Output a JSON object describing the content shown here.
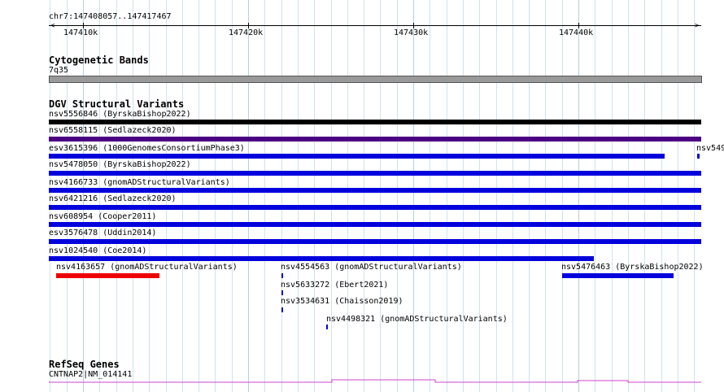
{
  "ruler": {
    "location": "chr7:147408057..147417467",
    "ticks": [
      "147410k",
      "147420k",
      "147430k",
      "147440k"
    ]
  },
  "tracks": {
    "cytoband": {
      "title": "Cytogenetic Bands",
      "band": "7q35",
      "color": "#999999"
    },
    "dgv": {
      "title": "DGV Structural Variants",
      "features": [
        {
          "label": "nsv5556846 (ByrskaBishop2022)",
          "color": "#000000"
        },
        {
          "label": "nsv6558115 (Sedlazeck2020)",
          "color": "#4b0082"
        },
        {
          "label": "esv3615396 (1000GenomesConsortiumPhase3)",
          "color": "#0000dd"
        },
        {
          "label": "nsv549",
          "color": "#0000dd"
        },
        {
          "label": "nsv5478050 (ByrskaBishop2022)",
          "color": "#0000dd"
        },
        {
          "label": "nsv4166733 (gnomADStructuralVariants)",
          "color": "#0000dd"
        },
        {
          "label": "nsv6421216 (Sedlazeck2020)",
          "color": "#0000dd"
        },
        {
          "label": "nsv608954 (Cooper2011)",
          "color": "#0000dd"
        },
        {
          "label": "esv3576478 (Uddin2014)",
          "color": "#0000dd"
        },
        {
          "label": "nsv1024540 (Coe2014)",
          "color": "#0000dd"
        },
        {
          "label": "nsv4163657 (gnomADStructuralVariants)",
          "color": "#ee0000"
        },
        {
          "label": "nsv4554563 (gnomADStructuralVariants)",
          "color": "#0000dd"
        },
        {
          "label": "nsv5476463 (ByrskaBishop2022)",
          "color": "#0000dd"
        },
        {
          "label": "nsv5633272 (Ebert2021)",
          "color": "#0000dd"
        },
        {
          "label": "nsv3534631 (Chaisson2019)",
          "color": "#0000dd"
        },
        {
          "label": "nsv4498321 (gnomADStructuralVariants)",
          "color": "#0000dd"
        }
      ]
    },
    "refseq": {
      "title": "RefSeq Genes",
      "gene": "CNTNAP2|NM_014141",
      "color": "#cc44cc"
    }
  }
}
